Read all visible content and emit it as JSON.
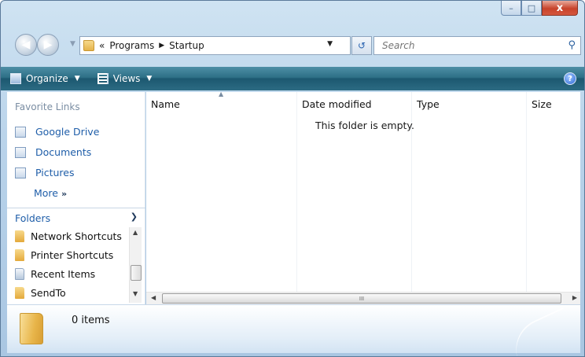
{
  "window": {
    "caption": {
      "minimize": "–",
      "maximize": "□",
      "close": "x"
    }
  },
  "address": {
    "overflow": "«",
    "path": [
      "Programs",
      "Startup"
    ],
    "search_placeholder": "Search"
  },
  "toolbar": {
    "organize_label": "Organize",
    "views_label": "Views",
    "help": "?"
  },
  "navpane": {
    "favorites_heading": "Favorite Links",
    "favorites": [
      {
        "label": "Google Drive",
        "icon": "google-drive-icon"
      },
      {
        "label": "Documents",
        "icon": "documents-icon"
      },
      {
        "label": "Pictures",
        "icon": "pictures-icon"
      }
    ],
    "more_label": "More",
    "more_chevron": "»",
    "folders_heading": "Folders",
    "folders": [
      {
        "label": "Network Shortcuts",
        "icon": "folder-icon"
      },
      {
        "label": "Printer Shortcuts",
        "icon": "folder-icon"
      },
      {
        "label": "Recent Items",
        "icon": "recent-items-icon"
      },
      {
        "label": "SendTo",
        "icon": "folder-icon"
      }
    ]
  },
  "filelist": {
    "columns": [
      "Name",
      "Date modified",
      "Type",
      "Size"
    ],
    "empty_message": "This folder is empty.",
    "hscroll_grip": "III"
  },
  "details": {
    "item_count": "0 items"
  }
}
